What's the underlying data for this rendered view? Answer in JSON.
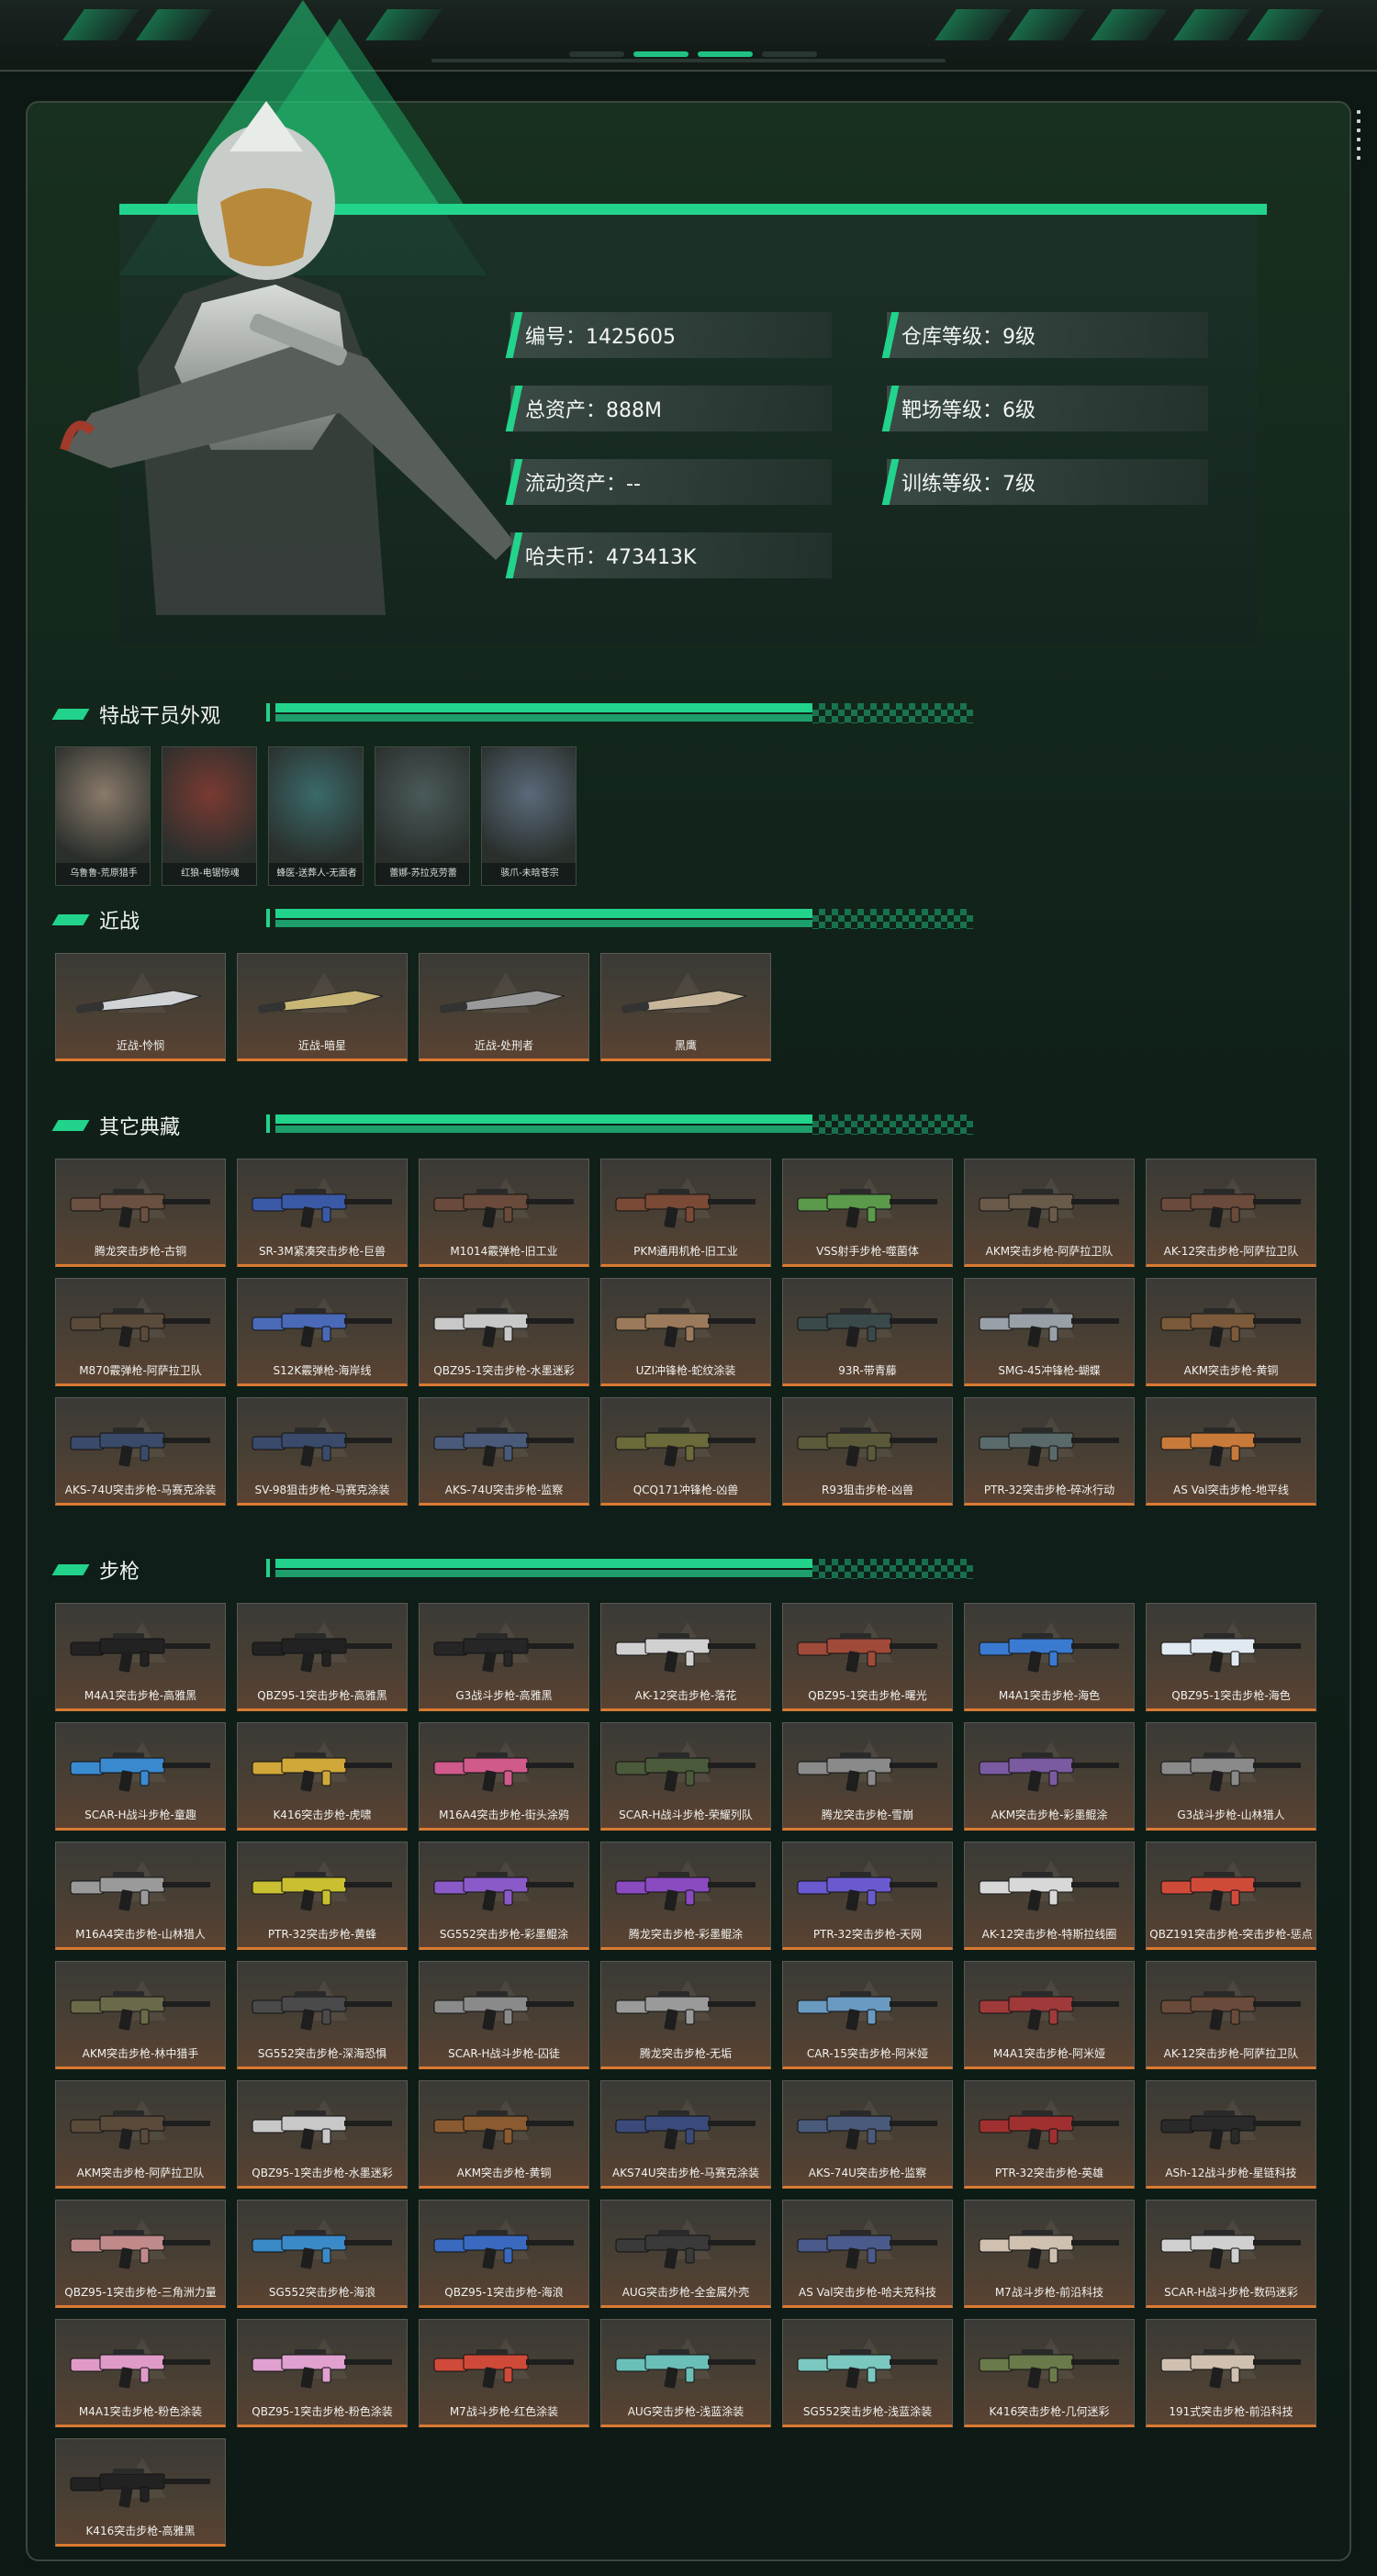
{
  "profile": {
    "stats_left": [
      {
        "label": "编号：1425605"
      },
      {
        "label": "总资产：888M"
      },
      {
        "label": "流动资产：--"
      },
      {
        "label": "哈夫币：473413K"
      }
    ],
    "stats_right": [
      {
        "label": "仓库等级：9级"
      },
      {
        "label": "靶场等级：6级"
      },
      {
        "label": "训练等级：7级"
      }
    ]
  },
  "sections": {
    "operators": "特战干员外观",
    "melee": "近战",
    "collectibles": "其它典藏",
    "rifles": "步枪"
  },
  "operators": [
    {
      "name": "乌鲁鲁-荒原猎手",
      "color": "#8a7a6a"
    },
    {
      "name": "红狼-电锯惊魂",
      "color": "#7a3a32"
    },
    {
      "name": "蜂医-送葬人-无面者",
      "color": "#3a6a6a"
    },
    {
      "name": "蕾娜-苏拉克劳蕾",
      "color": "#4a5a5a"
    },
    {
      "name": "骇爪-未晗苍宗",
      "color": "#5a6a7a"
    }
  ],
  "melee": [
    {
      "name": "近战-怜悯",
      "color": "#cfd3d6"
    },
    {
      "name": "近战-暗星",
      "color": "#c8b676"
    },
    {
      "name": "近战-处刑者",
      "color": "#9a9a9a"
    },
    {
      "name": "黑鹰",
      "color": "#c7b69a"
    }
  ],
  "collectibles": [
    {
      "name": "腾龙突击步枪-古铜",
      "color": "#6a5040"
    },
    {
      "name": "SR-3M紧凑突击步枪-巨兽",
      "color": "#3a5aa8"
    },
    {
      "name": "M1014霰弹枪-旧工业",
      "color": "#6a4a3a"
    },
    {
      "name": "PKM通用机枪-旧工业",
      "color": "#7a4a36"
    },
    {
      "name": "VSS射手步枪-噬菌体",
      "color": "#5a9a4a"
    },
    {
      "name": "AKM突击步枪-阿萨拉卫队",
      "color": "#6a5a4a"
    },
    {
      "name": "AK-12突击步枪-阿萨拉卫队",
      "color": "#6a4a3a"
    },
    {
      "name": "M870霰弹枪-阿萨拉卫队",
      "color": "#5a4a3a"
    },
    {
      "name": "S12K霰弹枪-海岸线",
      "color": "#4a6ab8"
    },
    {
      "name": "QBZ95-1突击步枪-水墨迷彩",
      "color": "#c8c8c8"
    },
    {
      "name": "UZI冲锋枪-蛇纹涂装",
      "color": "#9a7a5a"
    },
    {
      "name": "93R-带青藤",
      "color": "#3a4a4a"
    },
    {
      "name": "SMG-45冲锋枪-蝴蝶",
      "color": "#9aa0a8"
    },
    {
      "name": "AKM突击步枪-黄铜",
      "color": "#7a5a3a"
    },
    {
      "name": "AKS-74U突击步枪-马赛克涂装",
      "color": "#3a4a6a"
    },
    {
      "name": "SV-98狙击步枪-马赛克涂装",
      "color": "#3a4a6a"
    },
    {
      "name": "AKS-74U突击步枪-监察",
      "color": "#4a5a7a"
    },
    {
      "name": "QCQ171冲锋枪-凶兽",
      "color": "#6a6a3a"
    },
    {
      "name": "R93狙击步枪-凶兽",
      "color": "#5a5a3a"
    },
    {
      "name": "PTR-32突击步枪-碎冰行动",
      "color": "#5a6a6a"
    },
    {
      "name": "AS Val突击步枪-地平线",
      "color": "#c87a3a"
    }
  ],
  "rifles": [
    {
      "name": "M4A1突击步枪-高雅黑",
      "color": "#222222"
    },
    {
      "name": "QBZ95-1突击步枪-高雅黑",
      "color": "#222222"
    },
    {
      "name": "G3战斗步枪-高雅黑",
      "color": "#262626"
    },
    {
      "name": "AK-12突击步枪-落花",
      "color": "#d0d0d0"
    },
    {
      "name": "QBZ95-1突击步枪-曙光",
      "color": "#a04a3a"
    },
    {
      "name": "M4A1突击步枪-海色",
      "color": "#3a7ad0"
    },
    {
      "name": "QBZ95-1突击步枪-海色",
      "color": "#e0e8f0"
    },
    {
      "name": "SCAR-H战斗步枪-童趣",
      "color": "#3a8ad0"
    },
    {
      "name": "K416突击步枪-虎啸",
      "color": "#d0a83a"
    },
    {
      "name": "M16A4突击步枪-街头涂鸦",
      "color": "#d05a8a"
    },
    {
      "name": "SCAR-H战斗步枪-荣耀列队",
      "color": "#4a5a3a"
    },
    {
      "name": "腾龙突击步枪-雪崩",
      "color": "#8a8a8a"
    },
    {
      "name": "AKM突击步枪-彩墨鲲涂",
      "color": "#7a5aa0"
    },
    {
      "name": "G3战斗步枪-山林猎人",
      "color": "#8a8a8a"
    },
    {
      "name": "M16A4突击步枪-山林猎人",
      "color": "#9a9a9a"
    },
    {
      "name": "PTR-32突击步枪-黄蜂",
      "color": "#c8c030"
    },
    {
      "name": "SG552突击步枪-彩墨鲲涂",
      "color": "#8a5ac8"
    },
    {
      "name": "腾龙突击步枪-彩墨鲲涂",
      "color": "#8a4ac0"
    },
    {
      "name": "PTR-32突击步枪-天网",
      "color": "#6a5ad0"
    },
    {
      "name": "AK-12突击步枪-特斯拉线圈",
      "color": "#d8d8d8"
    },
    {
      "name": "QBZ191突击步枪-突击步枪-惩点",
      "color": "#d04a3a"
    },
    {
      "name": "AKM突击步枪-林中猎手",
      "color": "#6a6a4a"
    },
    {
      "name": "SG552突击步枪-深海恐惧",
      "color": "#4a4a4a"
    },
    {
      "name": "SCAR-H战斗步枪-囚徒",
      "color": "#8a8a8a"
    },
    {
      "name": "腾龙突击步枪-无垢",
      "color": "#9a9a9a"
    },
    {
      "name": "CAR-15突击步枪-阿米娅",
      "color": "#6a9ac0"
    },
    {
      "name": "M4A1突击步枪-阿米娅",
      "color": "#a03a3a"
    },
    {
      "name": "AK-12突击步枪-阿萨拉卫队",
      "color": "#6a4a3a"
    },
    {
      "name": "AKM突击步枪-阿萨拉卫队",
      "color": "#5a4a3a"
    },
    {
      "name": "QBZ95-1突击步枪-水墨迷彩",
      "color": "#c8c8c8"
    },
    {
      "name": "AKM突击步枪-黄铜",
      "color": "#8a5a30"
    },
    {
      "name": "AKS74U突击步枪-马赛克涂装",
      "color": "#3a4a7a"
    },
    {
      "name": "AKS-74U突击步枪-监察",
      "color": "#4a5a7a"
    },
    {
      "name": "PTR-32突击步枪-英雄",
      "color": "#a03030"
    },
    {
      "name": "ASh-12战斗步枪-星链科技",
      "color": "#2a2a2a"
    },
    {
      "name": "QBZ95-1突击步枪-三角洲力量",
      "color": "#c08a8a"
    },
    {
      "name": "SG552突击步枪-海浪",
      "color": "#3a8ac8"
    },
    {
      "name": "QBZ95-1突击步枪-海浪",
      "color": "#3a6ac0"
    },
    {
      "name": "AUG突击步枪-全金属外壳",
      "color": "#3a3a3a"
    },
    {
      "name": "AS Val突击步枪-哈夫克科技",
      "color": "#4a5a8a"
    },
    {
      "name": "M7战斗步枪-前沿科技",
      "color": "#d0c0b0"
    },
    {
      "name": "SCAR-H战斗步枪-数码迷彩",
      "color": "#d0d0d0"
    },
    {
      "name": "M4A1突击步枪-粉色涂装",
      "color": "#e09ac8"
    },
    {
      "name": "QBZ95-1突击步枪-粉色涂装",
      "color": "#e0a0d0"
    },
    {
      "name": "M7战斗步枪-红色涂装",
      "color": "#d04a3a"
    },
    {
      "name": "AUG突击步枪-浅蓝涂装",
      "color": "#6ac0b8"
    },
    {
      "name": "SG552突击步枪-浅蓝涂装",
      "color": "#7ac8c0"
    },
    {
      "name": "K416突击步枪-几何迷彩",
      "color": "#6a7a4a"
    },
    {
      "name": "191式突击步枪-前沿科技",
      "color": "#d0c0b0"
    },
    {
      "name": "K416突击步枪-高雅黑",
      "color": "#222222"
    }
  ]
}
